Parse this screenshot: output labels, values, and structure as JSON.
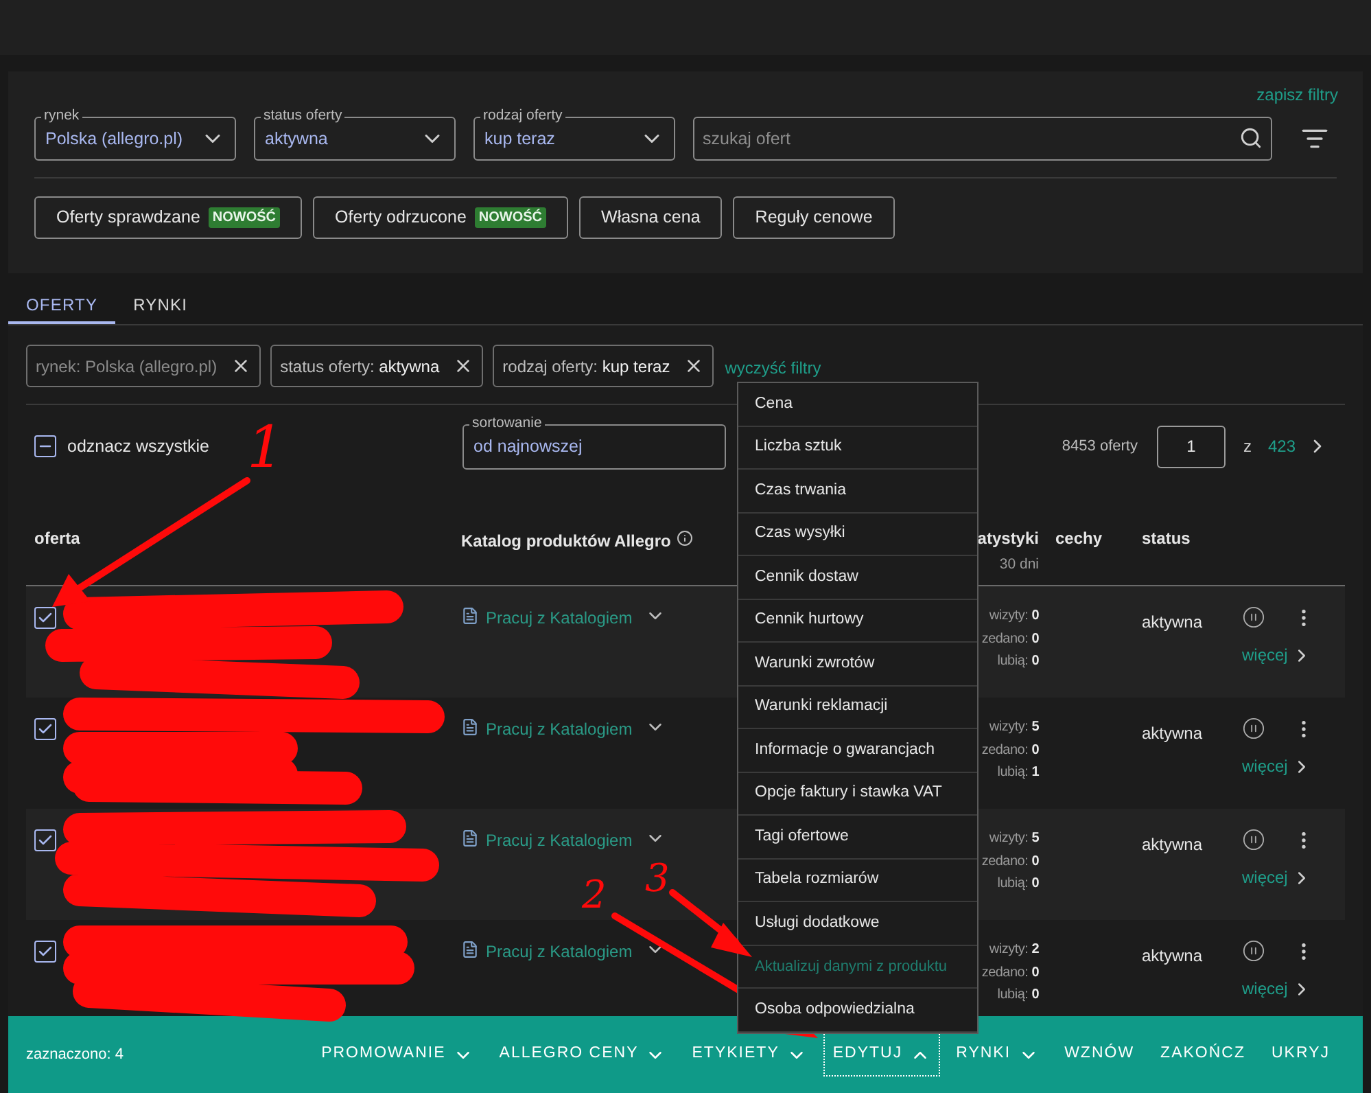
{
  "top_filters": {
    "save_link": "zapisz filtry",
    "fields": [
      {
        "label": "rynek",
        "value": "Polska (allegro.pl)"
      },
      {
        "label": "status oferty",
        "value": "aktywna"
      },
      {
        "label": "rodzaj oferty",
        "value": "kup teraz"
      }
    ],
    "search": {
      "placeholder": "szukaj ofert"
    },
    "buttons": [
      {
        "label": "Oferty sprawdzane",
        "badge": "NOWOŚĆ"
      },
      {
        "label": "Oferty odrzucone",
        "badge": "NOWOŚĆ"
      },
      {
        "label": "Własna cena"
      },
      {
        "label": "Reguły cenowe"
      }
    ]
  },
  "tabs": [
    {
      "label": "OFERTY",
      "selected": true
    },
    {
      "label": "RYNKI",
      "selected": false
    }
  ],
  "active_filters": {
    "chips": [
      {
        "label": "rynek:",
        "value": "Polska (allegro.pl)",
        "disabled": true
      },
      {
        "label": "status oferty:",
        "value": "aktywna",
        "disabled": false
      },
      {
        "label": "rodzaj oferty:",
        "value": "kup teraz",
        "disabled": false
      }
    ],
    "clear_link": "wyczyść filtry"
  },
  "toolbar": {
    "select_all": {
      "label": "odznacz wszystkie",
      "indeterminate": true
    },
    "sort": {
      "label": "sortowanie",
      "value": "od najnowszej"
    },
    "count": "8453 oferty",
    "page": "1",
    "of": "z",
    "total_pages": "423"
  },
  "table": {
    "columns": [
      {
        "label": "oferta"
      },
      {
        "label": "Katalog produktów Allegro",
        "info": true
      },
      {
        "label": "atystyki",
        "sub": "30 dni"
      },
      {
        "label": "cechy"
      },
      {
        "label": "status"
      }
    ],
    "rows": [
      {
        "checked": true,
        "catalog": "Pracuj z Katalogiem",
        "stats": [
          {
            "label": "wizyty:",
            "value": "0"
          },
          {
            "label": "zedano:",
            "value": "0"
          },
          {
            "label": "lubią:",
            "value": "0"
          }
        ],
        "status": "aktywna",
        "more": "więcej"
      },
      {
        "checked": true,
        "catalog": "Pracuj z Katalogiem",
        "stats": [
          {
            "label": "wizyty:",
            "value": "5"
          },
          {
            "label": "zedano:",
            "value": "0"
          },
          {
            "label": "lubią:",
            "value": "1"
          }
        ],
        "status": "aktywna",
        "more": "więcej"
      },
      {
        "checked": true,
        "catalog": "Pracuj z Katalogiem",
        "stats": [
          {
            "label": "wizyty:",
            "value": "5"
          },
          {
            "label": "zedano:",
            "value": "0"
          },
          {
            "label": "lubią:",
            "value": "0"
          }
        ],
        "status": "aktywna",
        "more": "więcej"
      },
      {
        "checked": true,
        "catalog": "Pracuj z Katalogiem",
        "stats": [
          {
            "label": "wizyty:",
            "value": "2"
          },
          {
            "label": "zedano:",
            "value": "0"
          },
          {
            "label": "lubią:",
            "value": "0"
          }
        ],
        "status": "aktywna",
        "more": "więcej"
      }
    ]
  },
  "menu": {
    "items": [
      {
        "label": "Cena",
        "disabled": false
      },
      {
        "label": "Liczba sztuk",
        "disabled": false
      },
      {
        "label": "Czas trwania",
        "disabled": false
      },
      {
        "label": "Czas wysyłki",
        "disabled": false
      },
      {
        "label": "Cennik dostaw",
        "disabled": false
      },
      {
        "label": "Cennik hurtowy",
        "disabled": false
      },
      {
        "label": "Warunki zwrotów",
        "disabled": false
      },
      {
        "label": "Warunki reklamacji",
        "disabled": false
      },
      {
        "label": "Informacje o gwarancjach",
        "disabled": false
      },
      {
        "label": "Opcje faktury i stawka VAT",
        "disabled": false
      },
      {
        "label": "Tagi ofertowe",
        "disabled": false
      },
      {
        "label": "Tabela rozmiarów",
        "disabled": false
      },
      {
        "label": "Usługi dodatkowe",
        "disabled": false
      },
      {
        "label": "Aktualizuj danymi z produktu",
        "disabled": true
      },
      {
        "label": "Osoba odpowiedzialna",
        "disabled": false
      }
    ]
  },
  "action_bar": {
    "selected_count": "zaznaczono: 4",
    "actions": [
      {
        "label": "PROMOWANIE",
        "kind": "dropdown",
        "expanded": false
      },
      {
        "label": "ALLEGRO CENY",
        "kind": "dropdown",
        "expanded": false
      },
      {
        "label": "ETYKIETY",
        "kind": "dropdown",
        "expanded": false
      },
      {
        "label": "EDYTUJ",
        "kind": "dropdown",
        "expanded": true
      },
      {
        "label": "RYNKI",
        "kind": "dropdown",
        "expanded": false
      },
      {
        "label": "WZNÓW",
        "kind": "plain",
        "expanded": false
      },
      {
        "label": "ZAKOŃCZ",
        "kind": "plain",
        "expanded": false
      },
      {
        "label": "UKRYJ",
        "kind": "plain",
        "expanded": false
      }
    ]
  },
  "annotations": [
    {
      "label": "1"
    },
    {
      "label": "2"
    },
    {
      "label": "3"
    }
  ]
}
